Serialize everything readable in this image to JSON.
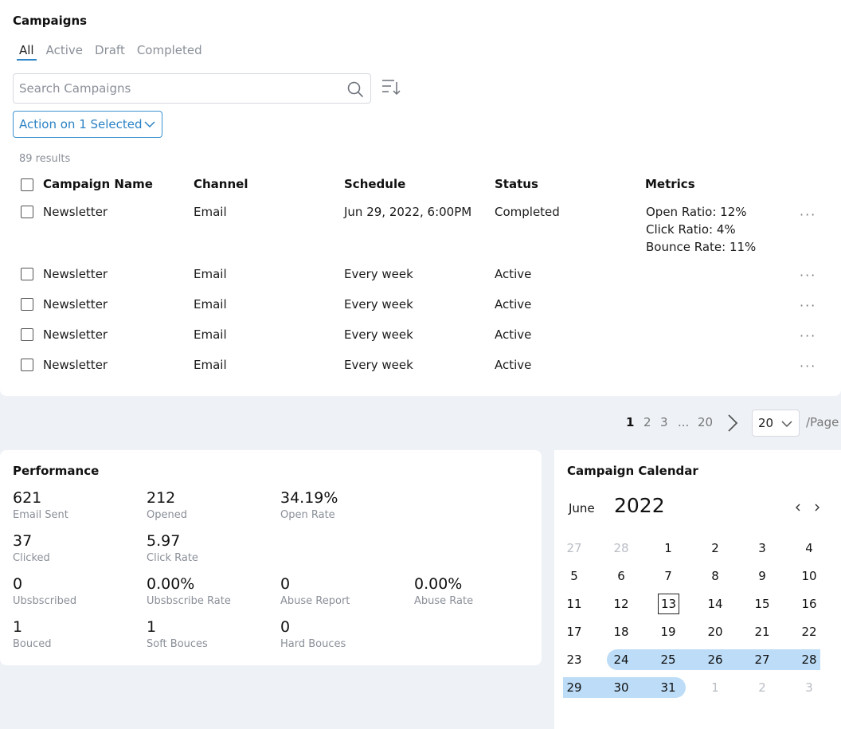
{
  "campaigns": {
    "title": "Campaigns",
    "tabs": [
      "All",
      "Active",
      "Draft",
      "Completed"
    ],
    "active_tab": "All",
    "search_placeholder": "Search Campaigns",
    "action_button": "Action on 1 Selected",
    "results_text": "89 results",
    "columns": [
      "Campaign Name",
      "Channel",
      "Schedule",
      "Status",
      "Metrics"
    ],
    "rows": [
      {
        "name": "Newsletter",
        "channel": "Email",
        "schedule": "Jun 29, 2022, 6:00PM",
        "status": "Completed",
        "metrics": [
          "Open Ratio: 12%",
          "Click Ratio: 4%",
          "Bounce Rate: 11%"
        ]
      },
      {
        "name": "Newsletter",
        "channel": "Email",
        "schedule": "Every week",
        "status": "Active",
        "metrics": []
      },
      {
        "name": "Newsletter",
        "channel": "Email",
        "schedule": "Every week",
        "status": "Active",
        "metrics": []
      },
      {
        "name": "Newsletter",
        "channel": "Email",
        "schedule": "Every week",
        "status": "Active",
        "metrics": []
      },
      {
        "name": "Newsletter",
        "channel": "Email",
        "schedule": "Every week",
        "status": "Active",
        "metrics": []
      }
    ],
    "more_label": "···"
  },
  "pagination": {
    "pages": [
      "1",
      "2",
      "3",
      "...",
      "20"
    ],
    "current": "1",
    "per_page": "20",
    "per_page_suffix": "/Page"
  },
  "performance": {
    "title": "Performance",
    "metrics": [
      {
        "value": "621",
        "label": "Email Sent"
      },
      {
        "value": "212",
        "label": "Opened"
      },
      {
        "value": "34.19%",
        "label": "Open Rate"
      },
      {
        "value": "37",
        "label": "Clicked"
      },
      {
        "value": "5.97",
        "label": "Click Rate"
      },
      {
        "value": "0",
        "label": "Ubsbscribed"
      },
      {
        "value": "0.00%",
        "label": "Ubsbscribe Rate"
      },
      {
        "value": "0",
        "label": "Abuse Report"
      },
      {
        "value": "0.00%",
        "label": "Abuse Rate"
      },
      {
        "value": "1",
        "label": "Bouced"
      },
      {
        "value": "1",
        "label": "Soft Bouces"
      },
      {
        "value": "0",
        "label": "Hard Bouces"
      }
    ]
  },
  "calendar": {
    "title": "Campaign Calendar",
    "month": "June",
    "year": "2022",
    "prev_icon": "chevron-left-icon",
    "next_icon": "chevron-right-icon",
    "weeks": [
      [
        "27",
        "28",
        "1",
        "2",
        "3",
        "4"
      ],
      [
        "5",
        "6",
        "7",
        "8",
        "9",
        "10"
      ],
      [
        "11",
        "12",
        "13",
        "14",
        "15",
        "16"
      ],
      [
        "17",
        "18",
        "19",
        "20",
        "21",
        "22"
      ],
      [
        "23",
        "24",
        "25",
        "26",
        "27",
        "28"
      ],
      [
        "29",
        "30",
        "31",
        "1",
        "2",
        "3"
      ]
    ],
    "muted_days": [
      [
        0,
        0
      ],
      [
        0,
        1
      ],
      [
        5,
        3
      ],
      [
        5,
        4
      ],
      [
        5,
        5
      ]
    ],
    "today": [
      2,
      2
    ],
    "selected_range": {
      "start": [
        4,
        1
      ],
      "end": [
        5,
        2
      ]
    },
    "range_color": "#bcdcf7"
  },
  "colors": {
    "accent": "#2e86c8"
  }
}
